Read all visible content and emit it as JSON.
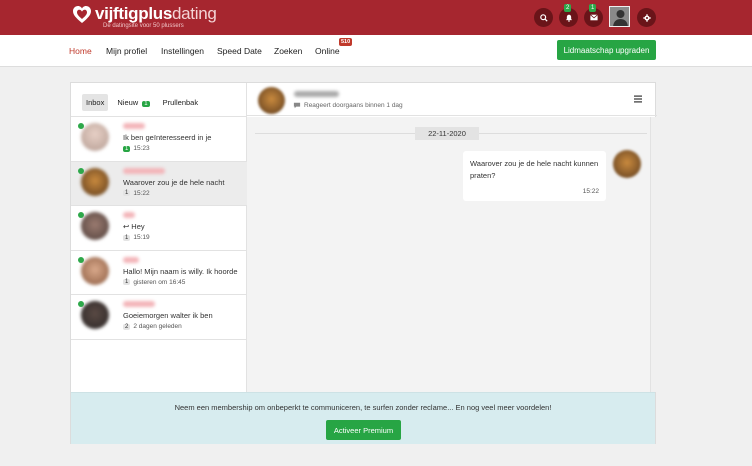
{
  "header": {
    "logo_bold": "vijftigplus",
    "logo_light": "dating",
    "tagline": "De datingsite voor 50 plussers",
    "search_icon": "search-icon",
    "notifications_icon": "bell-icon",
    "messages_icon": "envelope-icon",
    "settings_icon": "gear-icon",
    "notifications_count": "2",
    "messages_count": "1",
    "brand_color": "#a6262f"
  },
  "nav": {
    "items": [
      {
        "label": "Home"
      },
      {
        "label": "Mijn profiel"
      },
      {
        "label": "Instellingen"
      },
      {
        "label": "Speed Date"
      },
      {
        "label": "Zoeken"
      },
      {
        "label": "Online"
      }
    ],
    "online_count": "510",
    "upgrade_label": "Lidmaatschap upgraden"
  },
  "inbox": {
    "tabs": [
      {
        "label": "Inbox"
      },
      {
        "label": "Nieuw"
      },
      {
        "label": "Prullenbak"
      }
    ],
    "new_count": "1",
    "conversations": [
      {
        "message": "Ik ben geïnteresseerd in je",
        "count": "1",
        "time": "15:23",
        "online": true
      },
      {
        "message": "Waarover zou je de hele nacht",
        "count": "1",
        "time": "15:22",
        "online": true
      },
      {
        "message": "Hey",
        "count": "1",
        "time": "15:19",
        "online": true,
        "replied": true
      },
      {
        "message": "Hallo! Mijn naam is willy. Ik hoorde",
        "count": "1",
        "time": "gisteren om 16:45",
        "online": true
      },
      {
        "message": "Goeiemorgen walter ik ben",
        "count": "2",
        "time": "2 dagen geleden",
        "online": true
      }
    ]
  },
  "chat": {
    "status": "Reageert doorgaans binnen 1 dag",
    "date": "22-11-2020",
    "message": "Waarover zou je de hele nacht kunnen praten?",
    "message_time": "15:22",
    "menu_icon": "hamburger-icon"
  },
  "promo": {
    "text": "Neem een membership om onbeperkt te communiceren, te surfen zonder reclame... En nog veel meer voordelen!",
    "button_label": "Activeer Premium"
  },
  "accent_green": "#27a544"
}
